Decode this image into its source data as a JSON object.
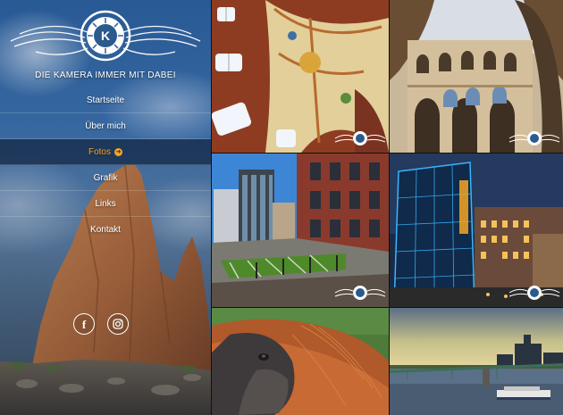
{
  "site": {
    "logo_letters": "K",
    "tagline": "DIE KAMERA IMMER MIT DABEI"
  },
  "nav": {
    "items": [
      {
        "label": "Startseite",
        "active": false
      },
      {
        "label": "Über mich",
        "active": false
      },
      {
        "label": "Fotos",
        "active": true
      },
      {
        "label": "Grafik",
        "active": false
      },
      {
        "label": "Links",
        "active": false
      },
      {
        "label": "Kontakt",
        "active": false
      }
    ],
    "active_arrow": "➜"
  },
  "social": {
    "facebook_label": "f",
    "instagram_icon": "instagram-icon"
  },
  "gallery": {
    "tiles": [
      {
        "name": "ceiling-vault-photo",
        "has_watermark": true
      },
      {
        "name": "courtyard-arches-photo",
        "has_watermark": true
      },
      {
        "name": "modern-buildings-photo",
        "has_watermark": true
      },
      {
        "name": "glass-tower-night-photo",
        "has_watermark": true
      },
      {
        "name": "orangutan-photo",
        "has_watermark": false
      },
      {
        "name": "river-bridge-photo",
        "has_watermark": false
      }
    ]
  },
  "colors": {
    "accent": "#f5a623",
    "nav_active_bg": "#14284a",
    "text": "#ffffff"
  }
}
